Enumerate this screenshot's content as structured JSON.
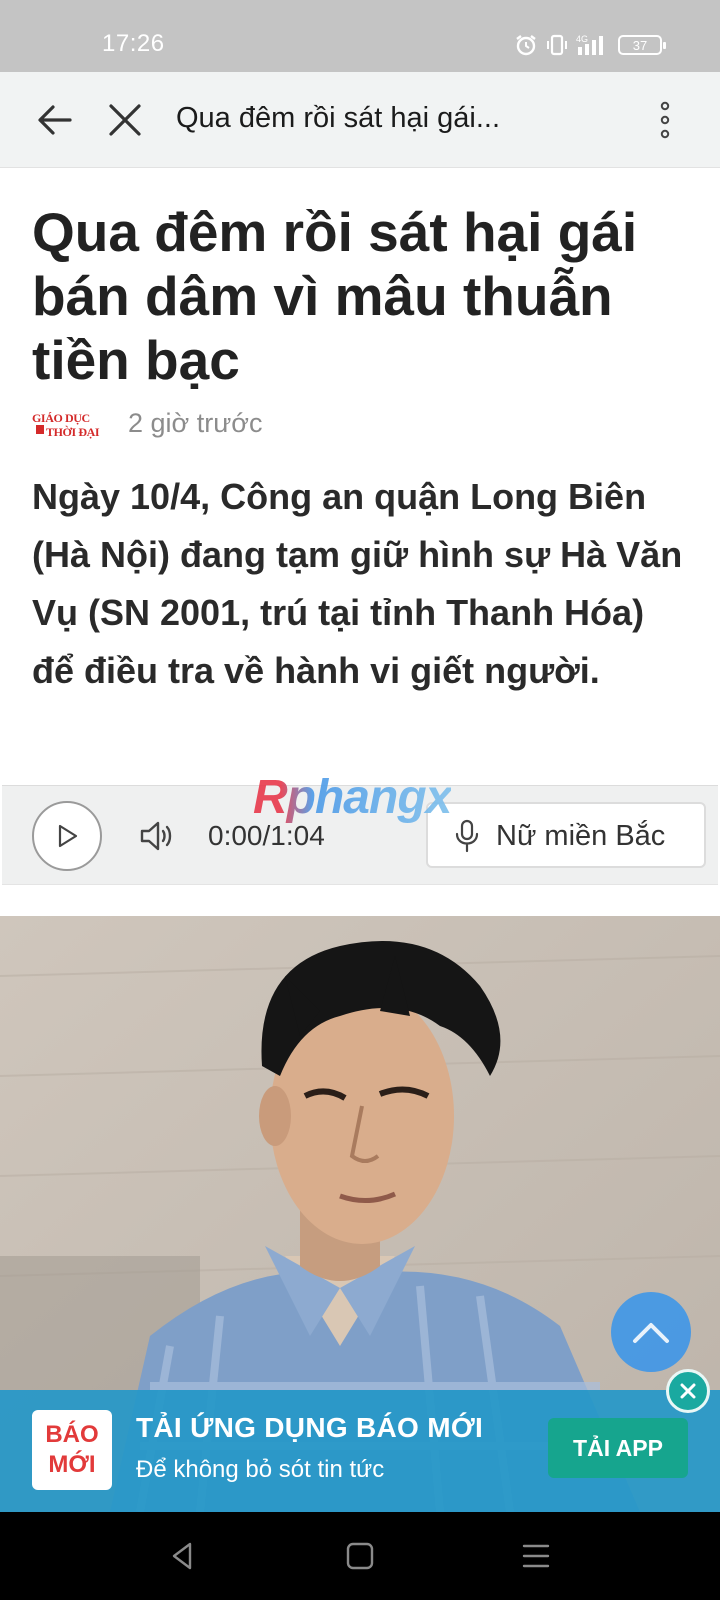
{
  "status_bar": {
    "time": "17:26",
    "network": "4G",
    "battery": "37"
  },
  "toolbar": {
    "title": "Qua đêm rồi sát hại gái..."
  },
  "article": {
    "title": "Qua đêm rồi sát hại gái bán dâm vì mâu thuẫn tiền bạc",
    "source_logo_text": "GIÁO DỤC THỜI ĐẠI",
    "time_ago": "2 giờ trước",
    "lead": "Ngày 10/4, Công an quận Long Biên (Hà Nội) đang tạm giữ hình sự Hà Văn Vụ (SN 2001, trú tại tỉnh Thanh Hóa) để điều tra về hành vi giết người."
  },
  "player": {
    "time": "0:00/1:04",
    "voice": "Nữ miền Bắc",
    "progress": 0
  },
  "watermark": "Rphangx",
  "banner": {
    "logo_line1": "BÁO",
    "logo_line2": "MỚI",
    "title": "TẢI ỨNG DỤNG BÁO MỚI",
    "subtitle": "Để không bỏ sót tin tức",
    "cta": "TẢI APP"
  },
  "colors": {
    "accent": "#2698c8",
    "cta": "#16a58e",
    "scroll_top": "#3a95e9",
    "logo_red": "#e23a3a"
  }
}
